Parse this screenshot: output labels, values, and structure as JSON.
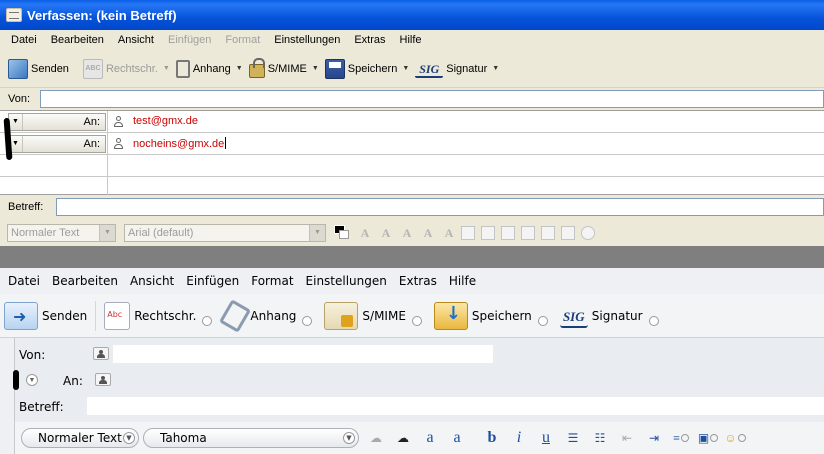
{
  "window1": {
    "title": "Verfassen: (kein Betreff)",
    "menu": [
      {
        "label": "Datei",
        "enabled": true
      },
      {
        "label": "Bearbeiten",
        "enabled": true
      },
      {
        "label": "Ansicht",
        "enabled": true
      },
      {
        "label": "Einfügen",
        "enabled": false
      },
      {
        "label": "Format",
        "enabled": false
      },
      {
        "label": "Einstellungen",
        "enabled": true
      },
      {
        "label": "Extras",
        "enabled": true
      },
      {
        "label": "Hilfe",
        "enabled": true
      }
    ],
    "toolbar": {
      "send": "Senden",
      "spell": "Rechtschr.",
      "attach": "Anhang",
      "smime": "S/MIME",
      "save": "Speichern",
      "sig_icon": "SIG",
      "signature": "Signatur"
    },
    "from_label": "Von:",
    "recipients": [
      {
        "type": "An:",
        "address": "test@gmx.de"
      },
      {
        "type": "An:",
        "address": "nocheins@gmx.de"
      }
    ],
    "subject_label": "Betreff:",
    "format": {
      "paragraph": "Normaler Text",
      "font": "Arial (default)"
    }
  },
  "window2": {
    "menu": [
      "Datei",
      "Bearbeiten",
      "Ansicht",
      "Einfügen",
      "Format",
      "Einstellungen",
      "Extras",
      "Hilfe"
    ],
    "toolbar": {
      "send": "Senden",
      "spell": "Rechtschr.",
      "attach": "Anhang",
      "smime": "S/MIME",
      "save": "Speichern",
      "sig_icon": "SIG",
      "signature": "Signatur"
    },
    "from_label": "Von:",
    "to_label": "An:",
    "subject_label": "Betreff:",
    "format": {
      "paragraph": "Normaler Text",
      "font": "Tahoma",
      "bold": "b",
      "italic": "i",
      "underline": "u"
    }
  },
  "colors": {
    "title_bar": "#0653d9",
    "address_text": "#cc0000",
    "classic_bg": "#ece9d8",
    "modern_bg": "#eef0f3"
  }
}
